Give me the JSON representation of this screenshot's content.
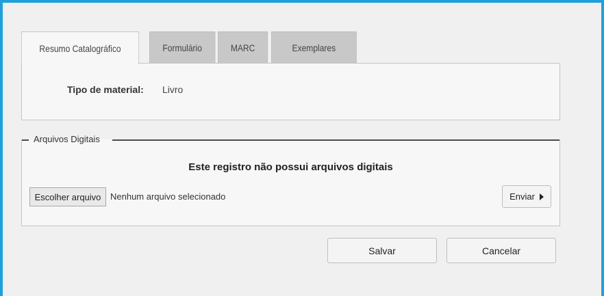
{
  "tabs": [
    {
      "label": "Resumo Catalográfico",
      "active": true
    },
    {
      "label": "Formulário",
      "active": false
    },
    {
      "label": "MARC",
      "active": false
    },
    {
      "label": "Exemplares",
      "active": false
    }
  ],
  "summary": {
    "material_label": "Tipo de material:",
    "material_value": "Livro"
  },
  "digital_files": {
    "legend": "Arquivos Digitais",
    "empty_message": "Este registro não possui arquivos digitais",
    "choose_file_label": "Escolher arquivo",
    "file_status": "Nenhum arquivo selecionado",
    "send_label": "Enviar"
  },
  "actions": {
    "save_label": "Salvar",
    "cancel_label": "Cancelar"
  },
  "colors": {
    "frame_accent": "#1ea0dc",
    "background": "#f0f0f0",
    "inactive_tab": "#c8c8c8"
  }
}
